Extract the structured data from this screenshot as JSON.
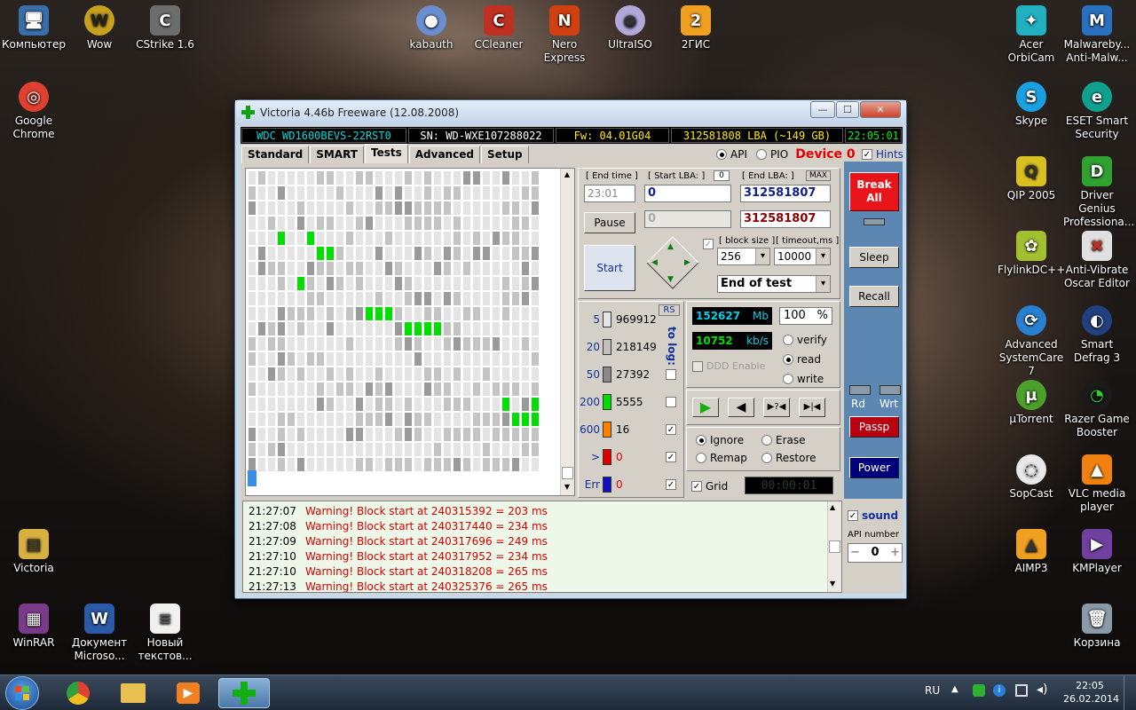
{
  "desktop": {
    "left_icons": [
      {
        "label": "Компьютер",
        "glyph": "🖥"
      },
      {
        "label": "Wow",
        "glyph": "W"
      },
      {
        "label": "CStrike 1.6",
        "glyph": "C"
      },
      {
        "label": "kabauth",
        "glyph": "●"
      },
      {
        "label": "CCleaner",
        "glyph": "C"
      },
      {
        "label": "Nero Express",
        "glyph": "N"
      },
      {
        "label": "UltraISO",
        "glyph": "◉"
      },
      {
        "label": "2ГИС",
        "glyph": "2"
      },
      {
        "label": "Google Chrome",
        "glyph": "◎"
      },
      {
        "label": "Victoria",
        "glyph": "▤"
      },
      {
        "label": "WinRAR",
        "glyph": "▦"
      },
      {
        "label": "Документ Microso...",
        "glyph": "W"
      },
      {
        "label": "Новый текстов...",
        "glyph": "≡"
      }
    ],
    "right_icons": [
      {
        "label": "Acer OrbiCam",
        "glyph": "✦"
      },
      {
        "label": "Malwareby... Anti-Malw...",
        "glyph": "M"
      },
      {
        "label": "Skype",
        "glyph": "S"
      },
      {
        "label": "ESET Smart Security",
        "glyph": "e"
      },
      {
        "label": "QIP 2005",
        "glyph": "Q"
      },
      {
        "label": "Driver Genius Professiona...",
        "glyph": "D"
      },
      {
        "label": "FlylinkDC++",
        "glyph": "✿"
      },
      {
        "label": "Anti-Vibrate Oscar Editor",
        "glyph": "✖"
      },
      {
        "label": "Advanced SystemCare 7",
        "glyph": "⟳"
      },
      {
        "label": "Smart Defrag 3",
        "glyph": "◐"
      },
      {
        "label": "µTorrent",
        "glyph": "µ"
      },
      {
        "label": "Razer Game Booster",
        "glyph": "◔"
      },
      {
        "label": "SopCast",
        "glyph": "◌"
      },
      {
        "label": "VLC media player",
        "glyph": "▲"
      },
      {
        "label": "AIMP3",
        "glyph": "▲"
      },
      {
        "label": "KMPlayer",
        "glyph": "▶"
      },
      {
        "label": "Корзина",
        "glyph": "🗑"
      }
    ]
  },
  "window": {
    "title": "Victoria 4.46b Freeware (12.08.2008)",
    "min": "—",
    "max": "☐",
    "close": "✕",
    "info": {
      "model": "WDC WD1600BEVS-22RST0",
      "serial": "SN: WD-WXE107288022",
      "fw": "Fw: 04.01G04",
      "lba": "312581808 LBA (~149 GB)",
      "time": "22:05:01"
    },
    "tabs": [
      "Standard",
      "SMART",
      "Tests",
      "Advanced",
      "Setup"
    ],
    "api_label": "API",
    "pio_label": "PIO",
    "device_label": "Device 0",
    "hints_label": "Hints",
    "end_time_label": "[ End time ]",
    "end_time_value": "23:01",
    "start_lba_label": "[ Start LBA: ]",
    "start_lba_small": "0",
    "start_lba_value": "0",
    "end_lba_label": "[ End LBA: ]",
    "end_lba_max": "MAX",
    "end_lba_value": "312581807",
    "pos_value": "0",
    "cur_lba_value": "312581807",
    "pause_label": "Pause",
    "start_label": "Start",
    "block_size_label": "[ block size ]",
    "block_size_value": "256",
    "timeout_label": "[ timeout,ms ]",
    "timeout_value": "10000",
    "end_action": "End of test",
    "rs_label": "RS",
    "tolog_label": "to log:",
    "legend": [
      {
        "ms": "5",
        "count": "969912",
        "color": "#e6e6e6"
      },
      {
        "ms": "20",
        "count": "218149",
        "color": "#c0c0c0"
      },
      {
        "ms": "50",
        "count": "27392",
        "color": "#8a8a8a"
      },
      {
        "ms": "200",
        "count": "5555",
        "color": "#00dd00"
      },
      {
        "ms": "600",
        "count": "16",
        "color": "#ff8000"
      },
      {
        "ms": ">",
        "count": "0",
        "color": "#e00000"
      },
      {
        "ms": "Err",
        "count": "0",
        "color": "#1010c0"
      }
    ],
    "mb_value": "152627",
    "mb_unit": "Mb",
    "percent_value": "100",
    "percent_unit": "%",
    "speed_value": "10752",
    "speed_unit": "kb/s",
    "ddd_label": "DDD Enable",
    "modes": [
      "verify",
      "read",
      "write"
    ],
    "nav_labels": [
      "▶",
      "◀",
      "▶?◀",
      "▶|◀"
    ],
    "actions": [
      "Ignore",
      "Erase",
      "Remap",
      "Restore"
    ],
    "grid_label": "Grid",
    "timer": "00:00:01",
    "break_label": "Break All",
    "sleep_label": "Sleep",
    "recall_label": "Recall",
    "rd_label": "Rd",
    "wrt_label": "Wrt",
    "passp_label": "Passp",
    "power_label": "Power",
    "sound_label": "sound",
    "api_number_label": "API number",
    "api_number_value": "0",
    "log": [
      {
        "t": "21:27:07",
        "m": "Warning! Block start at 240315392 = 203 ms"
      },
      {
        "t": "21:27:08",
        "m": "Warning! Block start at 240317440 = 234 ms"
      },
      {
        "t": "21:27:09",
        "m": "Warning! Block start at 240317696 = 249 ms"
      },
      {
        "t": "21:27:10",
        "m": "Warning! Block start at 240317952 = 234 ms"
      },
      {
        "t": "21:27:10",
        "m": "Warning! Block start at 240318208 = 265 ms"
      },
      {
        "t": "21:27:13",
        "m": "Warning! Block start at 240325376 = 265 ms"
      }
    ]
  },
  "taskbar": {
    "lang": "RU",
    "time": "22:05",
    "date": "26.02.2014"
  }
}
